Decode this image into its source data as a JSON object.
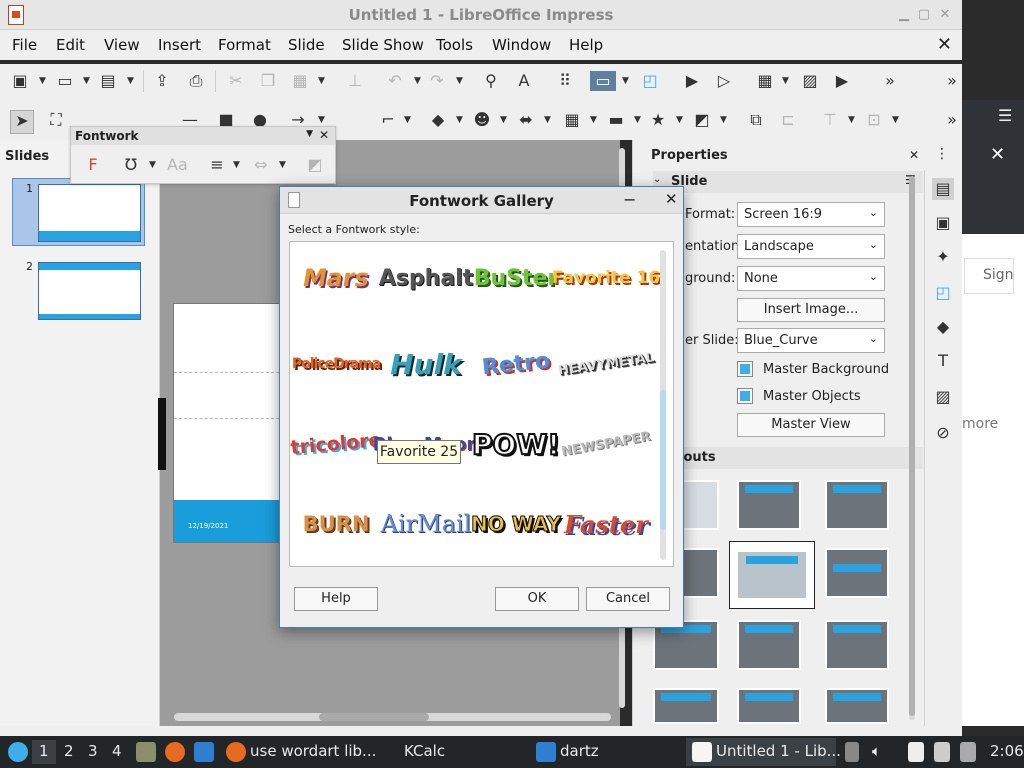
{
  "window": {
    "title": "Untitled 1 - LibreOffice Impress",
    "controls": [
      "▁",
      "▢",
      "✕"
    ]
  },
  "menu": [
    "File",
    "Edit",
    "View",
    "Insert",
    "Format",
    "Slide",
    "Slide Show",
    "Tools",
    "Window",
    "Help"
  ],
  "slides_pane": {
    "header": "Slides",
    "thumbnails": [
      {
        "num": "1"
      },
      {
        "num": "2"
      }
    ]
  },
  "slide": {
    "date": "12/19/2021"
  },
  "fontwork_toolbar": {
    "title": "Fontwork",
    "menu_glyph": "▼",
    "close_glyph": "✕"
  },
  "dialog": {
    "title": "Fontwork Gallery",
    "minimize": "−",
    "close": "✕",
    "prompt": "Select a Fontwork style:",
    "styles": [
      "Mars",
      "Asphalt",
      "BuSter",
      "Favorite 16",
      "PoliceDrama",
      "Hulk",
      "Retro",
      "HEAVYMETAL",
      "tricolore",
      "Blue Moon",
      "POW!",
      "NEWSPAPER",
      "BURN",
      "AirMail",
      "NO WAY",
      "Faster"
    ],
    "tooltip": "Favorite 25",
    "buttons": {
      "help": "Help",
      "ok": "OK",
      "cancel": "Cancel"
    }
  },
  "sidebar": {
    "header": "Properties",
    "section": "Slide",
    "labels": {
      "format": "Format:",
      "orientation": "entation:",
      "background": "ground:",
      "master_slide": "er Slide:"
    },
    "values": {
      "format": "Screen 16:9",
      "orientation": "Landscape",
      "background": "None",
      "master_slide": "Blue_Curve"
    },
    "insert_image": "Insert Image...",
    "master_background": "Master Background",
    "master_objects": "Master Objects",
    "master_view": "Master View",
    "layouts_section": "youts"
  },
  "background_window": {
    "sign": "Sign",
    "more": "more"
  },
  "taskbar": {
    "desktops": [
      "1",
      "2",
      "3",
      "4"
    ],
    "tasks": [
      "use wordart lib...",
      "KCalc",
      "dartz",
      "Untitled 1 - Lib..."
    ],
    "clock": "2:06"
  },
  "colors": {
    "accent": "#3d7fc1",
    "slide_blue": "#1a9ddb",
    "taskbar": "#232629"
  }
}
